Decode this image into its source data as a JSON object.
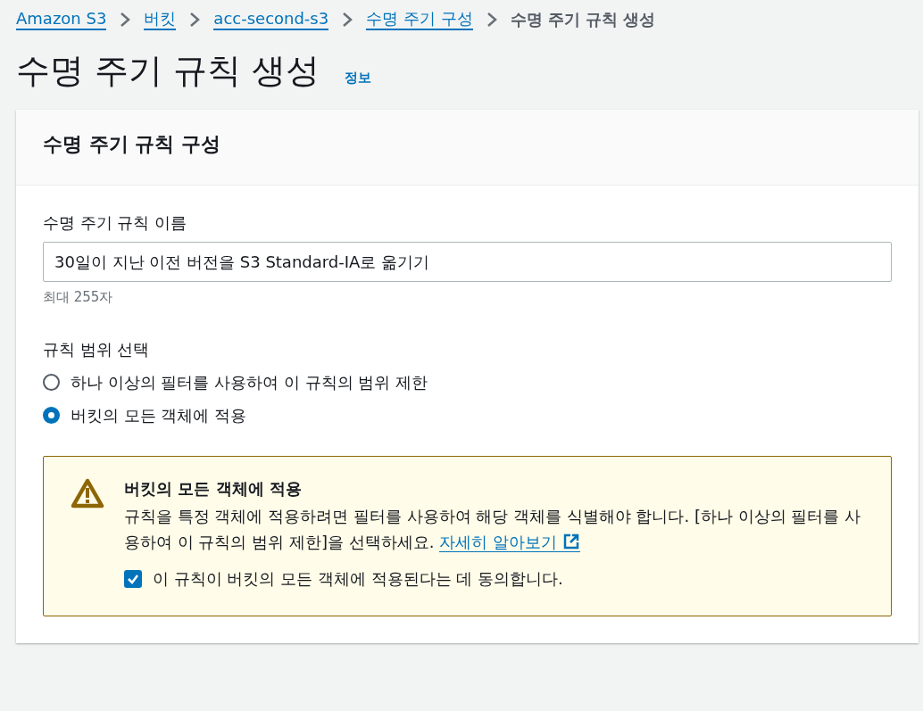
{
  "breadcrumb": [
    {
      "label": "Amazon S3",
      "kind": "link"
    },
    {
      "label": "버킷",
      "kind": "link"
    },
    {
      "label": "acc-second-s3",
      "kind": "link"
    },
    {
      "label": "수명 주기 구성",
      "kind": "link"
    },
    {
      "label": "수명 주기 규칙 생성",
      "kind": "current"
    }
  ],
  "page": {
    "title": "수명 주기 규칙 생성",
    "info_link": "정보"
  },
  "card": {
    "title": "수명 주기 규칙 구성",
    "name_field": {
      "label": "수명 주기 규칙 이름",
      "value": "30일이 지난 이전 버전을 S3 Standard-IA로 옮기기",
      "hint": "최대 255자"
    },
    "scope": {
      "label": "규칙 범위 선택",
      "options": [
        {
          "label": "하나 이상의 필터를 사용하여 이 규칙의 범위 제한",
          "selected": false
        },
        {
          "label": "버킷의 모든 객체에 적용",
          "selected": true
        }
      ]
    },
    "alert": {
      "title": "버킷의 모든 객체에 적용",
      "description": "규칙을 특정 객체에 적용하려면 필터를 사용하여 해당 객체를 식별해야 합니다. [하나 이상의 필터를 사용하여 이 규칙의 범위 제한]을 선택하세요.",
      "link": "자세히 알아보기",
      "consent": {
        "label": "이 규칙이 버킷의 모든 객체에 적용된다는 데 동의합니다.",
        "checked": true
      }
    }
  }
}
